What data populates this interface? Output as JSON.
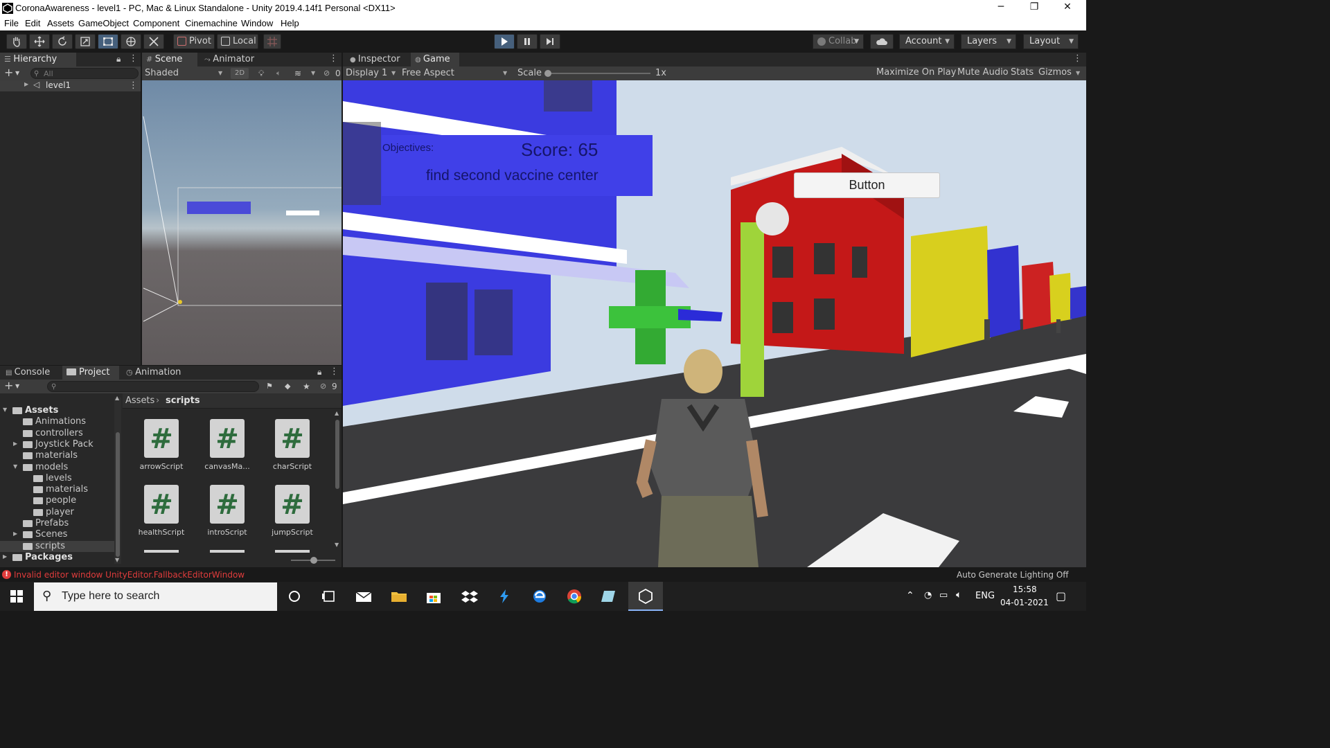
{
  "window": {
    "title": "CoronaAwareness - level1 - PC, Mac & Linux Standalone - Unity 2019.4.14f1 Personal <DX11>",
    "minimize": "─",
    "maximize": "❐",
    "close": "✕"
  },
  "menu": [
    "File",
    "Edit",
    "Assets",
    "GameObject",
    "Component",
    "Cinemachine",
    "Window",
    "Help"
  ],
  "toolbar": {
    "pivot": "Pivot",
    "local": "Local",
    "collab": "Collab",
    "account": "Account",
    "layers": "Layers",
    "layout": "Layout"
  },
  "hierarchy": {
    "tab": "Hierarchy",
    "search_placeholder": "All",
    "items": [
      {
        "label": "level1"
      }
    ]
  },
  "scene": {
    "tab_scene": "Scene",
    "tab_animator": "Animator",
    "shading": "Shaded",
    "mode_2d": "2D",
    "hidden_count": "0"
  },
  "gameview": {
    "tab_inspector": "Inspector",
    "tab_game": "Game",
    "display": "Display 1",
    "aspect": "Free Aspect",
    "scale_label": "Scale",
    "scale_value": "1x",
    "scale_fraction": 0.0,
    "maximize_on_play": "Maximize On Play",
    "mute_audio": "Mute Audio",
    "stats": "Stats",
    "gizmos": "Gizmos",
    "hud": {
      "objectives_label": "Objectives:",
      "score": "Score: 65",
      "objective_text": "find second vaccine center",
      "button_label": "Button"
    }
  },
  "project": {
    "tab_console": "Console",
    "tab_project": "Project",
    "tab_animation": "Animation",
    "hidden_count": "9",
    "breadcrumb": [
      "Assets",
      "scripts"
    ],
    "tree": [
      {
        "label": "Assets",
        "depth": 0,
        "expanded": true,
        "bold": true
      },
      {
        "label": "Animations",
        "depth": 1
      },
      {
        "label": "controllers",
        "depth": 1
      },
      {
        "label": "Joystick Pack",
        "depth": 1,
        "collapsed": true
      },
      {
        "label": "materials",
        "depth": 1
      },
      {
        "label": "models",
        "depth": 1,
        "expanded": true
      },
      {
        "label": "levels",
        "depth": 2
      },
      {
        "label": "materials",
        "depth": 2
      },
      {
        "label": "people",
        "depth": 2
      },
      {
        "label": "player",
        "depth": 2
      },
      {
        "label": "Prefabs",
        "depth": 1
      },
      {
        "label": "Scenes",
        "depth": 1,
        "collapsed": true
      },
      {
        "label": "scripts",
        "depth": 1,
        "selected": true
      },
      {
        "label": "Packages",
        "depth": 0,
        "collapsed": true,
        "bold": true
      }
    ],
    "files": [
      "arrowScript",
      "canvasMa...",
      "charScript",
      "healthScript",
      "introScript",
      "jumpScript"
    ]
  },
  "status": {
    "error": "Invalid editor window UnityEditor.FallbackEditorWindow",
    "lighting": "Auto Generate Lighting Off"
  },
  "taskbar": {
    "search_placeholder": "Type here to search",
    "language": "ENG",
    "time": "15:58",
    "date": "04-01-2021"
  },
  "colors": {
    "accent_blue": "#4848e8",
    "hud_panel": "#4040e8",
    "error_red": "#e03c3c",
    "play_active": "#46607c"
  }
}
